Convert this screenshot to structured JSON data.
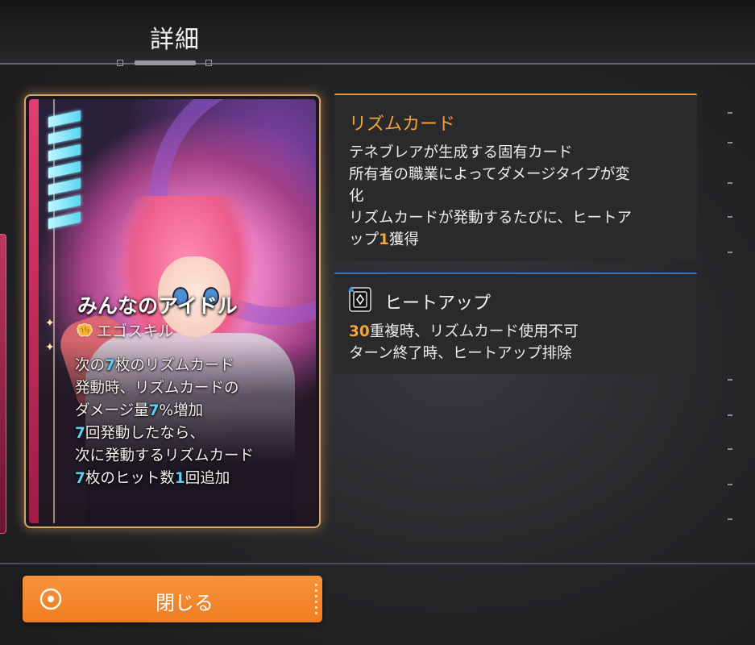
{
  "header": {
    "title": "詳細"
  },
  "card": {
    "name": "みんなのアイドル",
    "skill_type": "エゴスキル",
    "description_lines": [
      [
        {
          "t": "次の"
        },
        {
          "t": "7",
          "c": "blue"
        },
        {
          "t": "枚のリズムカード"
        }
      ],
      [
        {
          "t": "発動時、リズムカードの"
        }
      ],
      [
        {
          "t": "ダメージ量"
        },
        {
          "t": "7",
          "c": "blue"
        },
        {
          "t": "%増加"
        }
      ],
      [
        {
          "t": "7",
          "c": "blue"
        },
        {
          "t": "回発動したなら、"
        }
      ],
      [
        {
          "t": "次に発動するリズムカード"
        }
      ],
      [
        {
          "t": "7",
          "c": "blue"
        },
        {
          "t": "枚のヒット数"
        },
        {
          "t": "1",
          "c": "blue"
        },
        {
          "t": "回追加"
        }
      ]
    ],
    "cost_bars": 7
  },
  "rhythm_panel": {
    "title": "リズムカード",
    "body_lines": [
      [
        {
          "t": "テネブレアが生成する固有カード"
        }
      ],
      [
        {
          "t": "所有者の職業によってダメージタイプが変"
        }
      ],
      [
        {
          "t": "化"
        }
      ],
      [
        {
          "t": "リズムカードが発動するたびに、ヒートア"
        }
      ],
      [
        {
          "t": "ップ"
        },
        {
          "t": "1",
          "c": "orange"
        },
        {
          "t": "獲得"
        }
      ]
    ]
  },
  "heat_panel": {
    "icon": "card-diamond-icon",
    "title": "ヒートアップ",
    "body_lines": [
      [
        {
          "t": "30",
          "c": "orange"
        },
        {
          "t": "重複時、リズムカード使用不可"
        }
      ],
      [
        {
          "t": "ターン終了時、ヒートアップ排除"
        }
      ]
    ]
  },
  "footer": {
    "close_label": "閉じる",
    "close_icon": "target-circle-icon"
  },
  "colors": {
    "accent_orange": "#f2a43a",
    "accent_blue": "#5fd0f5",
    "button": "#f08a2e",
    "card_frame": "#d7a66a"
  }
}
